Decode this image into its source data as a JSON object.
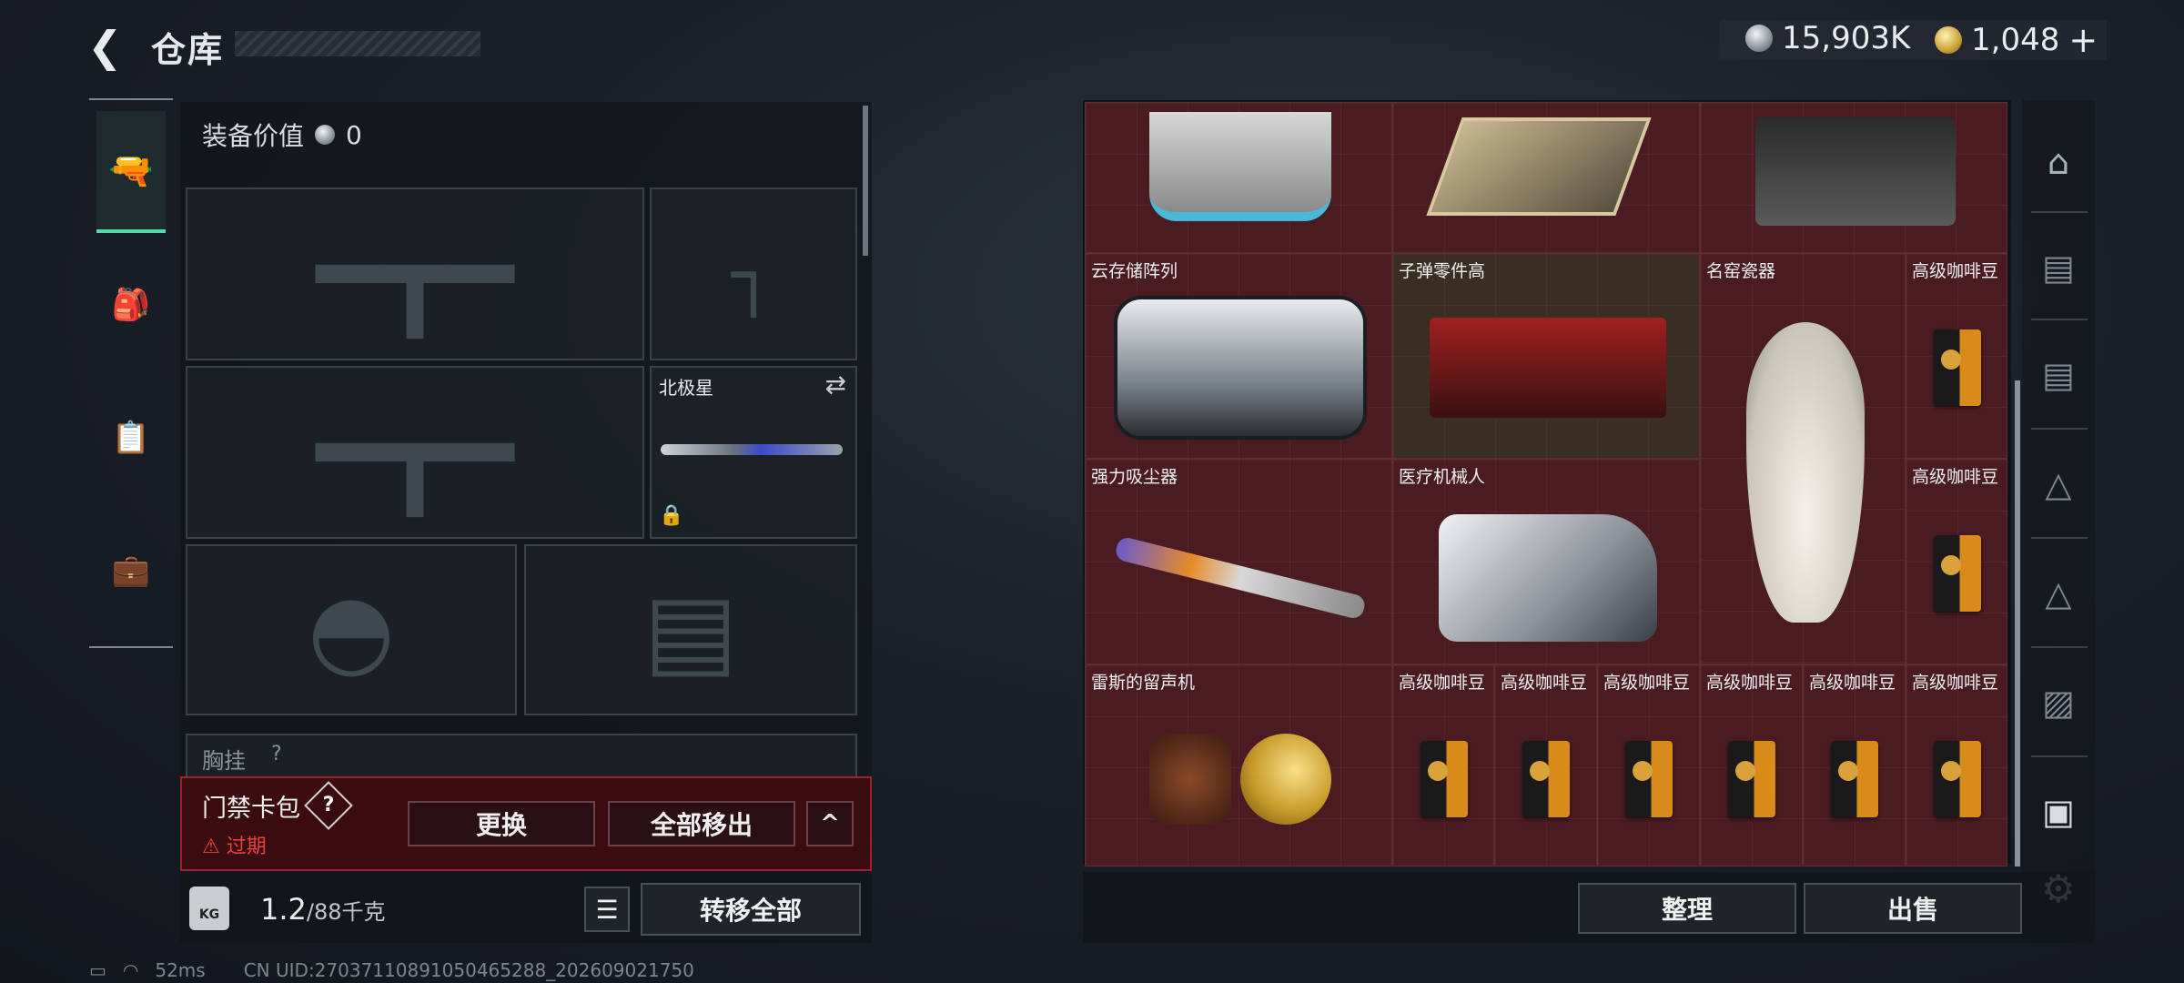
{
  "header": {
    "title": "仓库",
    "silver": "15,903K",
    "gold": "1,048"
  },
  "left_tabs": [
    {
      "name": "weapons",
      "icon": "pistol-icon"
    },
    {
      "name": "armor",
      "icon": "backpack-icon"
    },
    {
      "name": "rig",
      "icon": "chest-rig-icon"
    },
    {
      "name": "cases",
      "icon": "case-icon"
    }
  ],
  "loadout": {
    "value_label": "装备价值",
    "value": "0",
    "melee_name": "北极星",
    "chest_label": "胸挂",
    "chest_q": "?"
  },
  "keycard": {
    "title": "门禁卡包",
    "q": "?",
    "expired": "过期",
    "replace_btn": "更换",
    "remove_all_btn": "全部移出",
    "collapse": "^"
  },
  "weight": {
    "current": "1.2",
    "max": "/88千克",
    "kg": "KG",
    "transfer_btn": "转移全部"
  },
  "grid": {
    "items": [
      {
        "name": "云存储阵列"
      },
      {
        "name": "子弹零件高"
      },
      {
        "name": "名窑瓷器"
      },
      {
        "name": "强力吸尘器"
      },
      {
        "name": "医疗机械人"
      },
      {
        "name": "雷斯的留声机"
      },
      {
        "name": "高级咖啡豆"
      }
    ]
  },
  "actions": {
    "sort_btn": "整理",
    "sell_btn": "出售"
  },
  "status": {
    "ping": "52ms",
    "uid": "CN UID:27037110891050465288_202609021750"
  }
}
